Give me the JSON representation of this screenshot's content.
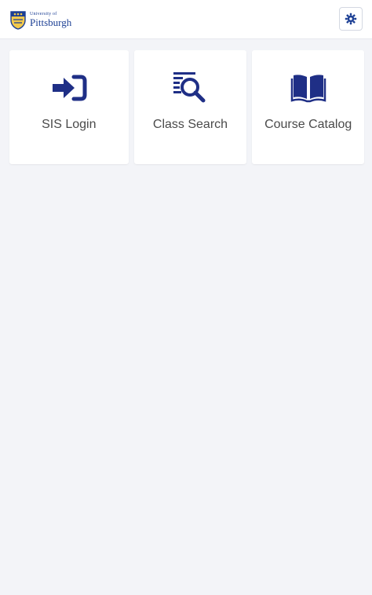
{
  "header": {
    "logo_small": "University of",
    "logo_big": "Pittsburgh",
    "settings_icon": "gear-icon"
  },
  "tiles": [
    {
      "label": "SIS Login",
      "icon": "sign-in-icon"
    },
    {
      "label": "Class Search",
      "icon": "search-list-icon"
    },
    {
      "label": "Course Catalog",
      "icon": "book-open-icon"
    }
  ],
  "colors": {
    "brand": "#1c3f94",
    "icon": "#1f2f86",
    "background": "#f3f4f8",
    "tile": "#ffffff",
    "label": "#4a4a4a"
  }
}
